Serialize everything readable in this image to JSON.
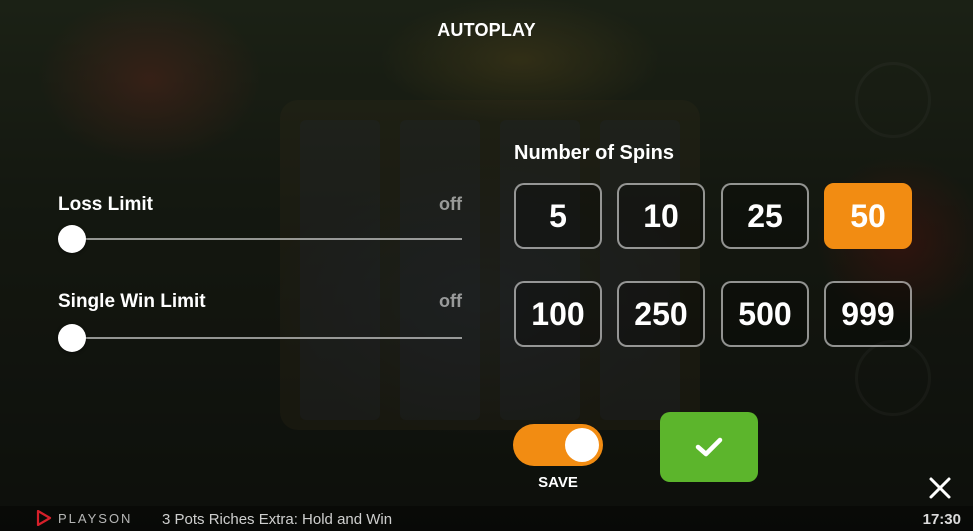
{
  "header": {
    "title": "AUTOPLAY"
  },
  "loss_limit": {
    "label": "Loss Limit",
    "value": "off",
    "level": 0
  },
  "single_win_limit": {
    "label": "Single Win Limit",
    "value": "off",
    "level": 0
  },
  "spins": {
    "title": "Number of Spins",
    "options": [
      "5",
      "10",
      "25",
      "50",
      "100",
      "250",
      "500",
      "999"
    ],
    "selected": "50"
  },
  "save": {
    "label": "SAVE",
    "enabled": true
  },
  "confirm": {
    "icon": "checkmark-icon"
  },
  "close": {
    "icon": "close-icon"
  },
  "footer": {
    "brand": "PLAYSON",
    "game_name": "3 Pots Riches Extra: Hold and Win",
    "time": "17:30"
  },
  "colors": {
    "accent": "#f28c12",
    "confirm": "#5cb52c",
    "brand_red": "#d6202a"
  }
}
